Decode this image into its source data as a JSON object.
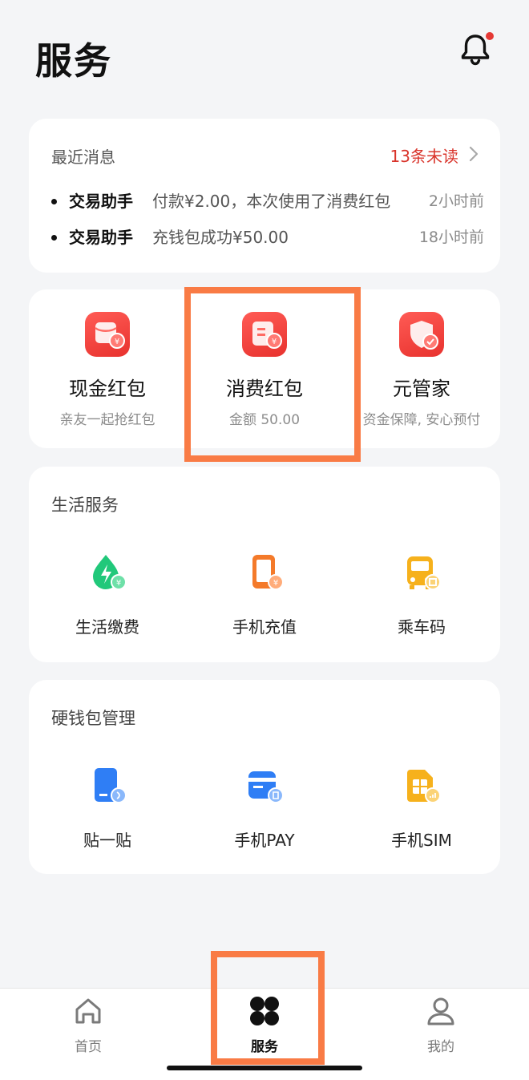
{
  "header": {
    "title": "服务"
  },
  "messages": {
    "title": "最近消息",
    "unread": "13条未读",
    "items": [
      {
        "sender": "交易助手",
        "content": "付款¥2.00，本次使用了消费红包",
        "time": "2小时前"
      },
      {
        "sender": "交易助手",
        "content": "充钱包成功¥50.00",
        "time": "18小时前"
      }
    ]
  },
  "packets": [
    {
      "name": "现金红包",
      "sub": "亲友一起抢红包",
      "icon": "red-envelope-icon"
    },
    {
      "name": "消费红包",
      "sub": "金额 50.00",
      "icon": "coupon-icon"
    },
    {
      "name": "元管家",
      "sub": "资金保障, 安心预付",
      "icon": "shield-icon"
    }
  ],
  "life": {
    "title": "生活服务",
    "items": [
      {
        "name": "生活缴费",
        "icon": "utility-bill-icon"
      },
      {
        "name": "手机充值",
        "icon": "phone-topup-icon"
      },
      {
        "name": "乘车码",
        "icon": "bus-code-icon"
      }
    ]
  },
  "hardware": {
    "title": "硬钱包管理",
    "items": [
      {
        "name": "贴一贴",
        "icon": "tap-card-icon"
      },
      {
        "name": "手机PAY",
        "icon": "phone-pay-icon"
      },
      {
        "name": "手机SIM",
        "icon": "sim-card-icon"
      }
    ]
  },
  "nav": {
    "items": [
      {
        "label": "首页",
        "icon": "home-icon"
      },
      {
        "label": "服务",
        "icon": "services-grid-icon",
        "active": true
      },
      {
        "label": "我的",
        "icon": "profile-icon"
      }
    ]
  },
  "colors": {
    "accent_red": "#e8322e",
    "unread_red": "#d9342b",
    "highlight_orange": "#f97b45",
    "background": "#f4f5f7"
  }
}
